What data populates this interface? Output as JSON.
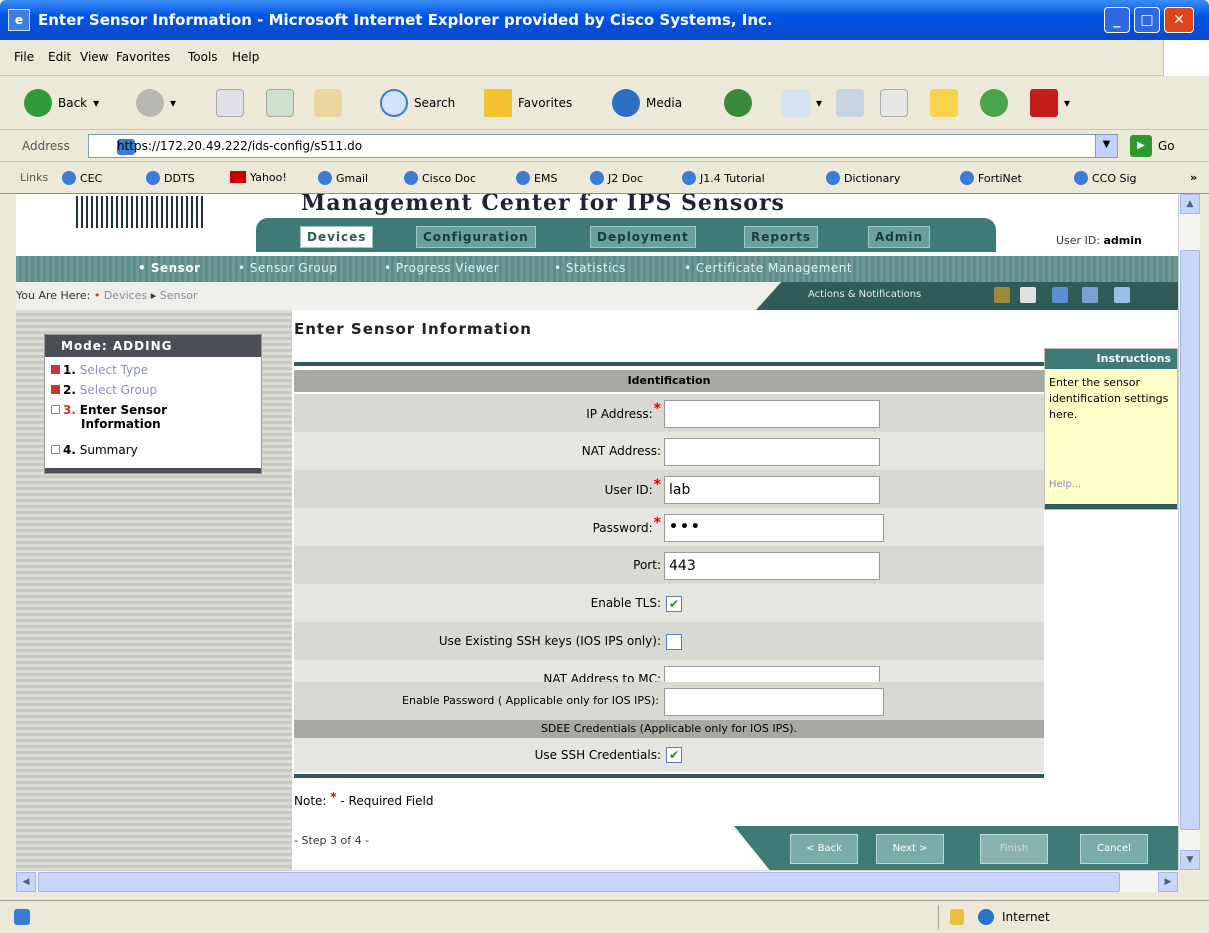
{
  "window": {
    "title": "Enter Sensor Information - Microsoft Internet Explorer provided by Cisco Systems, Inc."
  },
  "menu": [
    "File",
    "Edit",
    "View",
    "Favorites",
    "Tools",
    "Help"
  ],
  "toolbar": {
    "back": "Back",
    "search": "Search",
    "favorites": "Favorites",
    "media": "Media"
  },
  "address": {
    "label": "Address",
    "url": "https://172.20.49.222/ids-config/s511.do",
    "go": "Go"
  },
  "links": {
    "label": "Links",
    "items": [
      "CEC",
      "DDTS",
      "Yahoo!",
      "Gmail",
      "Cisco Doc",
      "EMS",
      "J2 Doc",
      "J1.4 Tutorial",
      "Dictionary",
      "FortiNet",
      "CCO Sig"
    ]
  },
  "app": {
    "title": "Management Center for IPS Sensors",
    "tabs": [
      "Devices",
      "Configuration",
      "Deployment",
      "Reports",
      "Admin"
    ],
    "user_label": "User ID:",
    "user": "admin",
    "subnav": [
      "Sensor",
      "Sensor Group",
      "Progress Viewer",
      "Statistics",
      "Certificate Management"
    ],
    "breadcrumb": {
      "prefix": "You Are Here:",
      "items": [
        "Devices",
        "Sensor"
      ]
    },
    "actions_label": "Actions & Notifications"
  },
  "mode": {
    "title": "Mode: ADDING",
    "steps": [
      {
        "num": "1.",
        "label": "Select Type"
      },
      {
        "num": "2.",
        "label": "Select Group"
      },
      {
        "num": "3.",
        "label": "Enter Sensor",
        "label2": "Information"
      },
      {
        "num": "4.",
        "label": "Summary"
      }
    ]
  },
  "page": {
    "title": "Enter Sensor Information"
  },
  "form": {
    "section": "Identification",
    "ip_label": "IP Address:",
    "ip_value": "",
    "nat_label": "NAT Address:",
    "nat_value": "",
    "user_label": "User ID:",
    "user_value": "lab",
    "password_label": "Password:",
    "password_value": "•••",
    "port_label": "Port:",
    "port_value": "443",
    "tls_label": "Enable TLS:",
    "tls_checked": true,
    "ssh_keys_label": "Use Existing SSH keys (IOS IPS only):",
    "ssh_keys_checked": false,
    "nat_mc_label": "NAT Address to MC:",
    "nat_mc_value": "",
    "enable_pw_label": "Enable Password ( Applicable only for IOS IPS):",
    "enable_pw_value": "",
    "sdee_header": "SDEE Credentials (Applicable only for IOS IPS).",
    "use_ssh_label": "Use SSH Credentials:",
    "use_ssh_checked": true
  },
  "note": {
    "prefix": "Note:",
    "suffix": "- Required Field"
  },
  "step_indicator": "- Step 3 of 4 -",
  "buttons": {
    "back": "< Back",
    "next": "Next >",
    "finish": "Finish",
    "cancel": "Cancel"
  },
  "instructions": {
    "title": "Instructions",
    "text": "Enter the sensor identification settings here.",
    "help": "Help..."
  },
  "status": {
    "zone": "Internet"
  }
}
